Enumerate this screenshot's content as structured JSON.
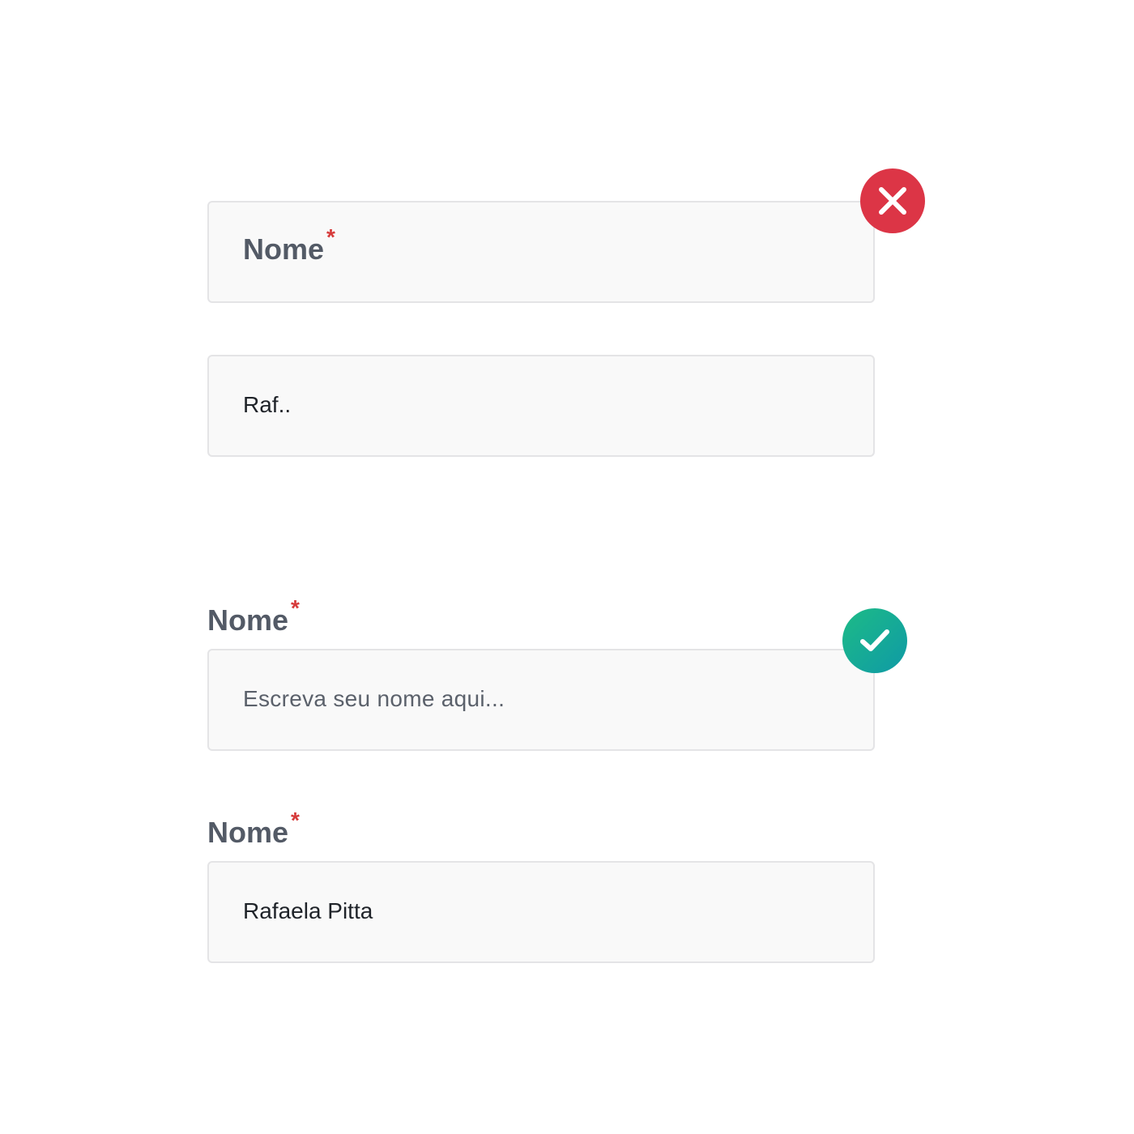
{
  "fields": [
    {
      "label": "Nome",
      "required_mark": "*",
      "status": "error",
      "status_icon": "close-icon"
    },
    {
      "value": "Raf.."
    },
    {
      "label": "Nome",
      "required_mark": "*",
      "placeholder": "Escreva seu nome aqui...",
      "status": "success",
      "status_icon": "check-icon"
    },
    {
      "label": "Nome",
      "required_mark": "*",
      "value": "Rafaela Pitta"
    }
  ],
  "colors": {
    "error": "#dc3546",
    "success_start": "#1dbb86",
    "success_end": "#0f9aa6",
    "required": "#d63a3a",
    "label": "#535a66",
    "field_bg": "#f9f9f9",
    "field_border": "#e4e4e6"
  }
}
